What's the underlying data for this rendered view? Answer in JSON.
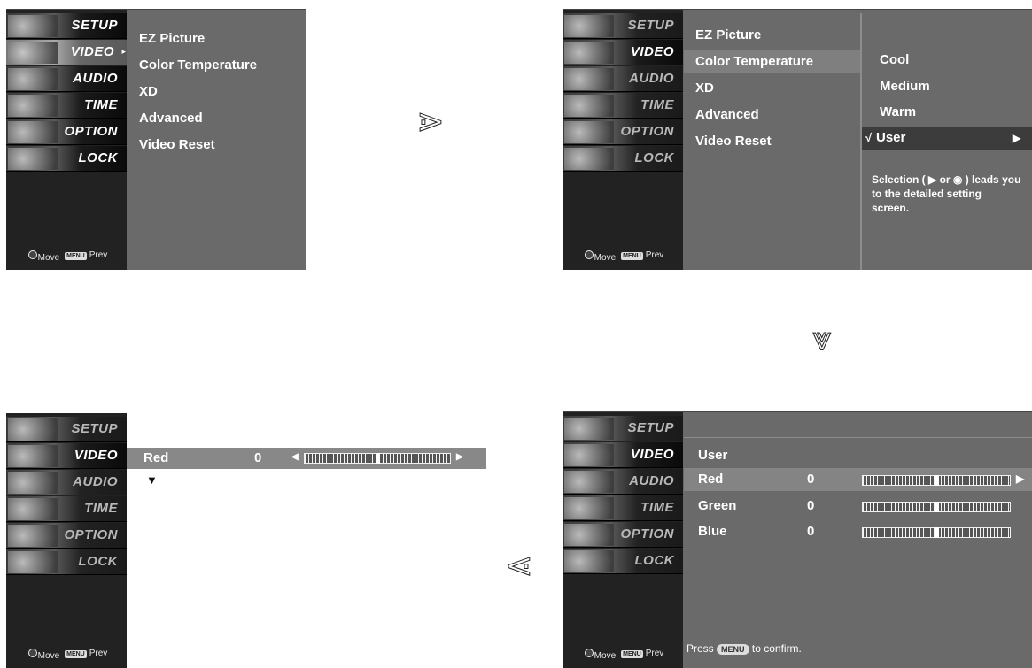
{
  "categories": [
    "SETUP",
    "VIDEO",
    "AUDIO",
    "TIME",
    "OPTION",
    "LOCK"
  ],
  "footer": {
    "move": "Move",
    "menu_key": "MENU",
    "prev": "Prev"
  },
  "video_menu": [
    "EZ Picture",
    "Color Temperature",
    "XD",
    "Advanced",
    "Video Reset"
  ],
  "color_temp_options": [
    "Cool",
    "Medium",
    "Warm"
  ],
  "user_option": {
    "check": "√",
    "label": "User",
    "arrow": "▶"
  },
  "help_lines": [
    "Selection ( ▶ or ◉ ) leads you",
    "to the detailed setting",
    "screen."
  ],
  "user_screen": {
    "title": "User",
    "rows": [
      {
        "name": "Red",
        "value": "0"
      },
      {
        "name": "Green",
        "value": "0"
      },
      {
        "name": "Blue",
        "value": "0"
      }
    ],
    "arrow": "▶",
    "press_prefix": "Press",
    "press_key": "MENU",
    "press_suffix": "to confirm."
  },
  "red_bar": {
    "name": "Red",
    "value": "0",
    "left_arrow": "◀",
    "right_arrow": "▶",
    "down_arrow": "▼"
  },
  "flow_arrows": {
    "right": "⋗",
    "down": "⩔",
    "left": "⋖"
  }
}
